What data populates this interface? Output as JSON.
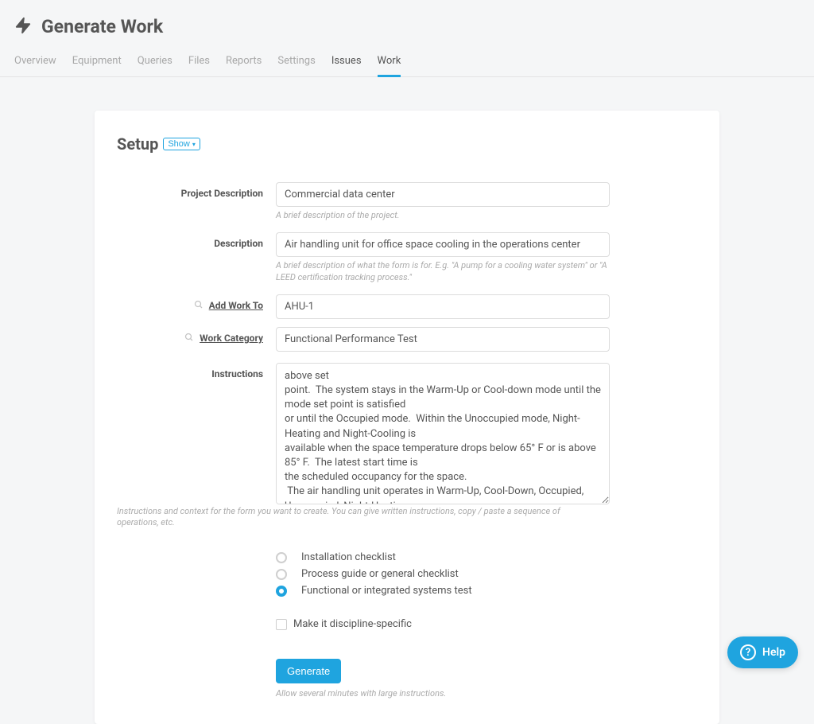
{
  "header": {
    "title": "Generate Work"
  },
  "tabs": [
    {
      "label": "Overview",
      "active": false
    },
    {
      "label": "Equipment",
      "active": false
    },
    {
      "label": "Queries",
      "active": false
    },
    {
      "label": "Files",
      "active": false
    },
    {
      "label": "Reports",
      "active": false
    },
    {
      "label": "Settings",
      "active": false
    },
    {
      "label": "Issues",
      "active": false,
      "dark": true
    },
    {
      "label": "Work",
      "active": true
    }
  ],
  "section": {
    "title": "Setup",
    "toggle_label": "Show"
  },
  "form": {
    "project_description": {
      "label": "Project Description",
      "value": "Commercial data center",
      "help": "A brief description of the project."
    },
    "description": {
      "label": "Description",
      "value": "Air handling unit for office space cooling in the operations center",
      "help": "A brief description of what the form is for. E.g. \"A pump for a cooling water system\" or \"A LEED certification tracking process.\""
    },
    "add_work_to": {
      "label": "Add Work To",
      "value": "AHU-1"
    },
    "work_category": {
      "label": "Work Category",
      "value": "Functional Performance Test"
    },
    "instructions": {
      "label": "Instructions",
      "value": "above set\npoint.  The system stays in the Warm-Up or Cool-down mode until the mode set point is satisfied\nor until the Occupied mode.  Within the Unoccupied mode, Night-Heating and Night-Cooling is\navailable when the space temperature drops below 65° F or is above 85° F.  The latest start time is\nthe scheduled occupancy for the space.\n The air handling unit operates in Warm-Up, Cool-Down, Occupied, Unoccupied, Night-Heating,\nNight-Cooling and modes as follows with adjustable set points and settings.\n Occupied mode:\n The air-handling unit shall be controlled by a local dedicated DDC control panel",
      "help": "Instructions and context for the form you want to create. You can give written instructions, copy / paste a sequence of operations, etc."
    },
    "form_type": {
      "options": [
        {
          "label": "Installation checklist",
          "checked": false
        },
        {
          "label": "Process guide or general checklist",
          "checked": false
        },
        {
          "label": "Functional or integrated systems test",
          "checked": true
        }
      ]
    },
    "discipline_specific": {
      "label": "Make it discipline-specific",
      "checked": false
    },
    "generate": {
      "label": "Generate",
      "help": "Allow several minutes with large instructions."
    }
  },
  "help_widget": {
    "label": "Help"
  }
}
